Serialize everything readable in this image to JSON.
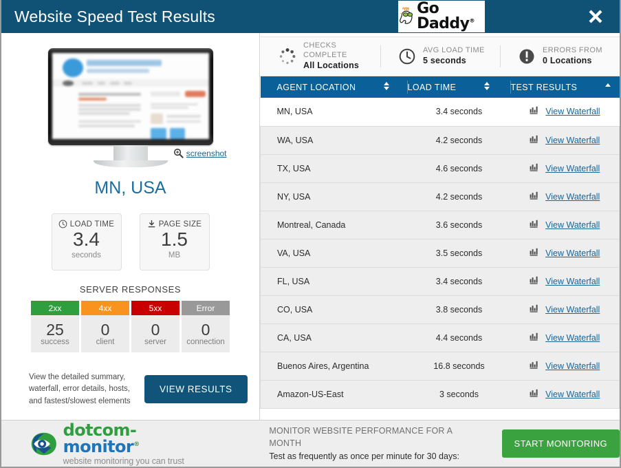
{
  "window": {
    "title": "Website Speed Test Results",
    "brand_logo": "go-daddy-logo",
    "brand_text_go": "Go",
    "brand_text_daddy": "Daddy",
    "brand_reg": "®",
    "close_label": "✖"
  },
  "left": {
    "screenshot_link": "screenshot",
    "location_title": "MN, USA",
    "metrics": [
      {
        "icon": "clock-icon",
        "label": "LOAD TIME",
        "value": "3.4",
        "unit": "seconds"
      },
      {
        "icon": "download-icon",
        "label": "PAGE SIZE",
        "value": "1.5",
        "unit": "MB"
      }
    ],
    "server_responses": {
      "title": "SERVER RESPONSES",
      "items": [
        {
          "code": "2xx",
          "count": "25",
          "label": "success",
          "color": "#2f9e3f"
        },
        {
          "code": "4xx",
          "count": "0",
          "label": "client",
          "color": "#f7931e"
        },
        {
          "code": "5xx",
          "count": "0",
          "label": "server",
          "color": "#c80000"
        },
        {
          "code": "Error",
          "count": "0",
          "label": "connection",
          "color": "#999999"
        }
      ]
    },
    "footer_note": "View the detailed summary, waterfall, error details, hosts, and fastest/slowest elements",
    "view_results_label": "VIEW RESULTS"
  },
  "right": {
    "stats": [
      {
        "icon": "spinner-icon",
        "top": "CHECKS COMPLETE",
        "bottom": "All Locations"
      },
      {
        "icon": "clock-icon",
        "top": "AVG LOAD TIME",
        "bottom": "5 seconds"
      },
      {
        "icon": "error-icon",
        "top": "ERRORS FROM",
        "bottom": "0 Locations"
      }
    ],
    "table": {
      "headers": [
        {
          "label": "AGENT LOCATION",
          "sort": "both"
        },
        {
          "label": "LOAD TIME",
          "sort": "both"
        },
        {
          "label": "TEST RESULTS",
          "sort": "asc"
        }
      ],
      "waterfall_label": "View Waterfall",
      "rows": [
        {
          "location": "MN, USA",
          "load_time": "3.4 seconds"
        },
        {
          "location": "WA, USA",
          "load_time": "4.2 seconds"
        },
        {
          "location": "TX, USA",
          "load_time": "4.6 seconds"
        },
        {
          "location": "NY, USA",
          "load_time": "4.2 seconds"
        },
        {
          "location": "Montreal, Canada",
          "load_time": "3.6 seconds"
        },
        {
          "location": "VA, USA",
          "load_time": "3.5 seconds"
        },
        {
          "location": "FL, USA",
          "load_time": "3.4 seconds"
        },
        {
          "location": "CO, USA",
          "load_time": "3.8 seconds"
        },
        {
          "location": "CA, USA",
          "load_time": "4.4 seconds"
        },
        {
          "location": "Buenos Aires, Argentina",
          "load_time": "16.8 seconds"
        },
        {
          "location": "Amazon-US-East",
          "load_time": "3 seconds"
        }
      ]
    }
  },
  "footer": {
    "logo_dotcom": "dotcom-",
    "logo_monitor": "monitor",
    "logo_reg": "®",
    "logo_tagline": "website monitoring you can trust",
    "promo_line1": "MONITOR WEBSITE PERFORMANCE FOR A MONTH",
    "promo_line2": "Test as frequently as once per minute for 30 days:",
    "start_label": "START MONITORING"
  },
  "colors": {
    "titlebar": "#0f5276",
    "table_header": "#0a6199",
    "link": "#1a6496",
    "accent_green": "#3aa340",
    "row_shade": "#eeeeee"
  },
  "chart_data": {
    "type": "table",
    "title": "Website Speed Test Results — Agent Load Times",
    "xlabel": "Agent Location",
    "ylabel": "Load Time (seconds)",
    "categories": [
      "MN, USA",
      "WA, USA",
      "TX, USA",
      "NY, USA",
      "Montreal, Canada",
      "VA, USA",
      "FL, USA",
      "CO, USA",
      "CA, USA",
      "Buenos Aires, Argentina",
      "Amazon-US-East"
    ],
    "values": [
      3.4,
      4.2,
      4.6,
      4.2,
      3.6,
      3.5,
      3.4,
      3.8,
      4.4,
      16.8,
      3.0
    ],
    "annotations": {
      "avg_load_time_seconds": 5,
      "errors_from_locations": 0,
      "checks_complete": "All Locations",
      "selected_agent": "MN, USA",
      "selected_load_time_seconds": 3.4,
      "selected_page_size_mb": 1.5,
      "server_responses": {
        "2xx": 25,
        "4xx": 0,
        "5xx": 0,
        "Error": 0
      }
    }
  }
}
